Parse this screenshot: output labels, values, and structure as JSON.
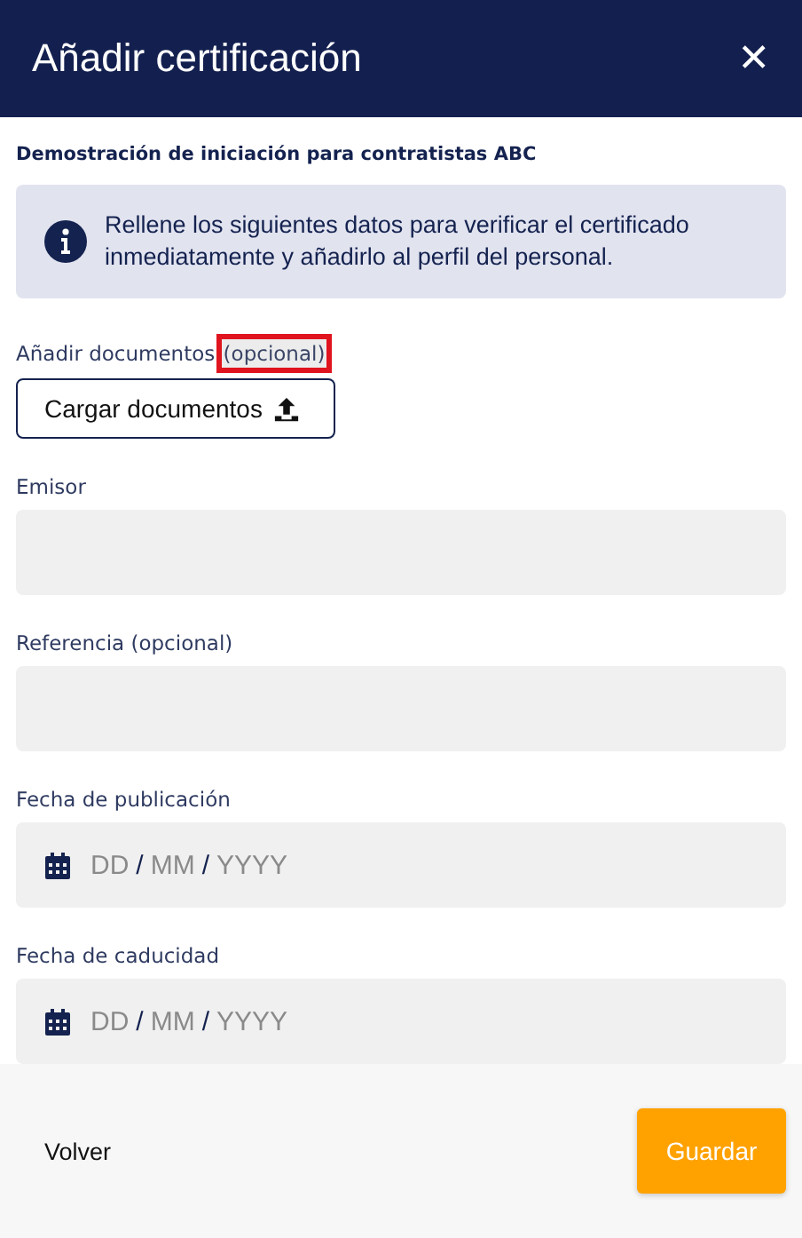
{
  "window": {
    "title": "Añadir certificación",
    "close": "✕"
  },
  "subtitle": "Demostración de iniciación para contratistas ABC",
  "info": "Rellene los siguientes datos para verificar el certificado inmediatamente y añadirlo al perfil del personal.",
  "upload": {
    "label": "Añadir documentos",
    "optional": "(opcional)",
    "optional_highlighted": true,
    "button": "Cargar documentos"
  },
  "fields": [
    {
      "kind": "text",
      "label": "Emisor"
    },
    {
      "kind": "text",
      "label": "Referencia (opcional)"
    },
    {
      "kind": "date",
      "label": "Fecha de publicación",
      "parts": [
        "DD",
        "/",
        "MM",
        "/",
        "YYYY"
      ]
    },
    {
      "kind": "date",
      "label": "Fecha de caducidad",
      "parts": [
        "DD",
        "/",
        "MM",
        "/",
        "YYYY"
      ]
    }
  ],
  "footer": {
    "back": "Volver",
    "save": "Guardar"
  }
}
